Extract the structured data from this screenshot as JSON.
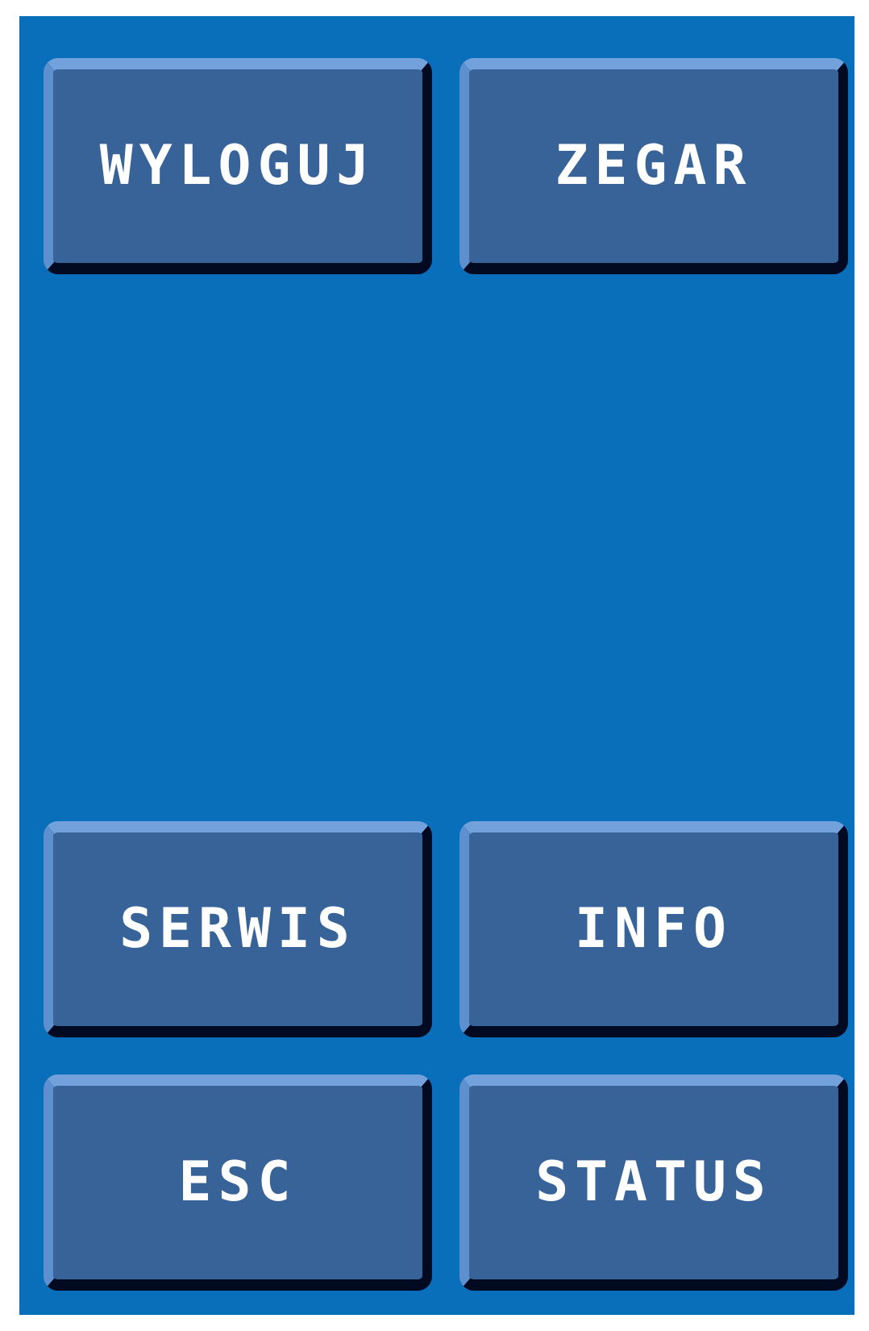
{
  "top_buttons": [
    "WYLOGUJ",
    "ZEGAR"
  ],
  "bottom_buttons": [
    "SERWIS",
    "INFO",
    "ESC",
    "STATUS"
  ]
}
